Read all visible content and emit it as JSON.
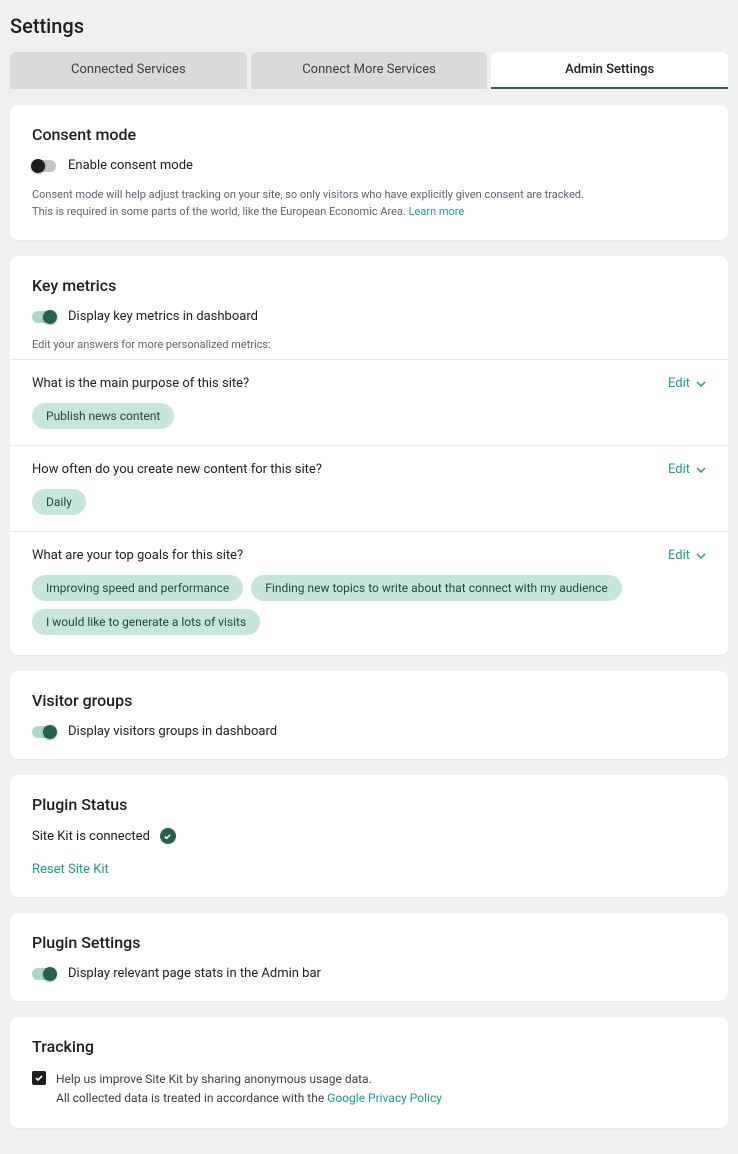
{
  "page_title": "Settings",
  "tabs": [
    {
      "label": "Connected Services"
    },
    {
      "label": "Connect More Services"
    },
    {
      "label": "Admin Settings"
    }
  ],
  "consent": {
    "title": "Consent mode",
    "toggle_label": "Enable consent mode",
    "help_line1": "Consent mode will help adjust tracking on your site, so only visitors who have explicitly given consent are tracked.",
    "help_line2": "This is required in some parts of the world, like the European Economic Area. ",
    "learn_more": "Learn more"
  },
  "key_metrics": {
    "title": "Key metrics",
    "toggle_label": "Display key metrics in dashboard",
    "sub_help": "Edit your answers for more personalized metrics:",
    "edit_label": "Edit",
    "questions": [
      {
        "text": "What is the main purpose of this site?",
        "chips": [
          "Publish news content"
        ]
      },
      {
        "text": "How often do you create new content for this site?",
        "chips": [
          "Daily"
        ]
      },
      {
        "text": "What are your top goals for this site?",
        "chips": [
          "Improving speed and performance",
          "Finding new topics to write about that connect with my audience",
          "I would like to generate a lots of visits"
        ]
      }
    ]
  },
  "visitor_groups": {
    "title": "Visitor groups",
    "toggle_label": "Display visitors groups in dashboard"
  },
  "plugin_status": {
    "title": "Plugin Status",
    "status_text": "Site Kit is connected",
    "reset_label": "Reset Site Kit"
  },
  "plugin_settings": {
    "title": "Plugin Settings",
    "toggle_label": "Display relevant page stats in the Admin bar"
  },
  "tracking": {
    "title": "Tracking",
    "checkbox_line1": "Help us improve Site Kit by sharing anonymous usage data.",
    "checkbox_line2": "All collected data is treated in accordance with the ",
    "privacy_link": "Google Privacy Policy"
  }
}
